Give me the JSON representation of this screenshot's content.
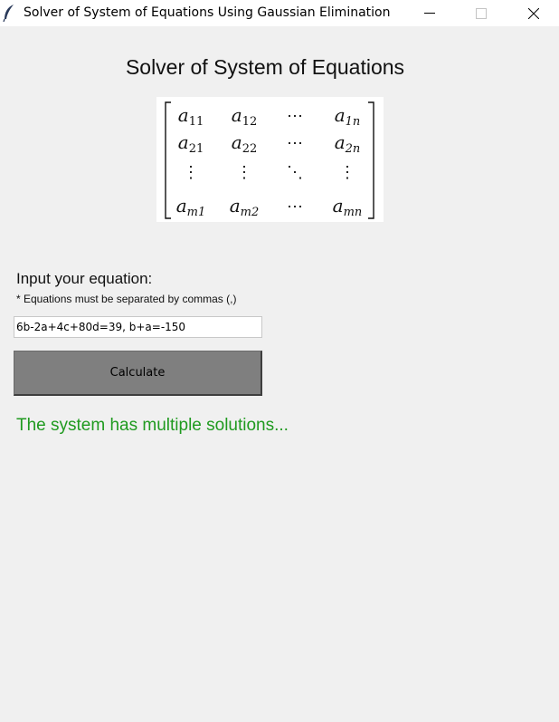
{
  "window": {
    "title": "Solver of System of Equations Using Gaussian Elimination"
  },
  "main": {
    "heading": "Solver of System of Equations",
    "matrix_image": {
      "rows": [
        [
          "a11",
          "a12",
          "⋯",
          "a1n"
        ],
        [
          "a21",
          "a22",
          "⋯",
          "a2n"
        ],
        [
          "⋮",
          "⋮",
          "⋱",
          "⋮"
        ],
        [
          "am1",
          "am2",
          "⋯",
          "amn"
        ]
      ]
    },
    "input_label": "Input your equation:",
    "input_note": "* Equations must be separated by commas (,)",
    "equation_value": "6b-2a+4c+80d=39, b+a=-150",
    "calculate_label": "Calculate",
    "result": "The system has multiple solutions...",
    "result_color": "#1f9a1f"
  }
}
